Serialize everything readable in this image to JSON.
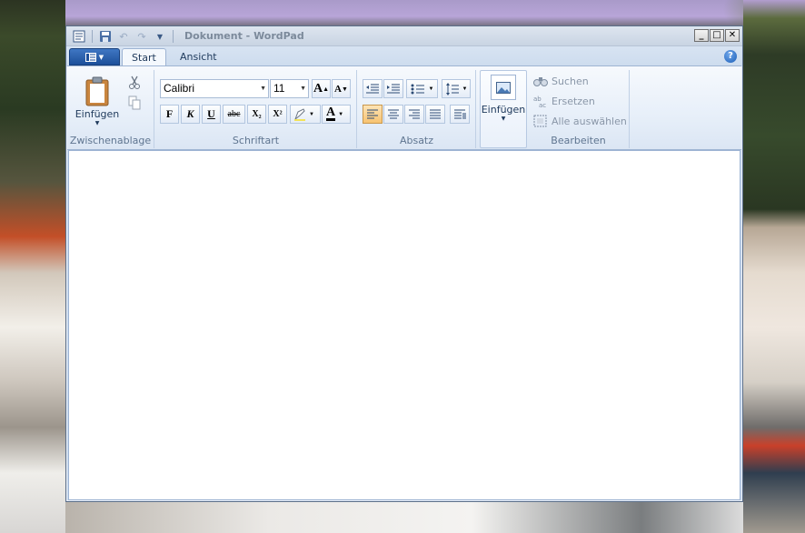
{
  "window": {
    "title": "Dokument - WordPad"
  },
  "tabs": [
    {
      "label": "Start",
      "active": true
    },
    {
      "label": "Ansicht",
      "active": false
    }
  ],
  "groups": {
    "clipboard": {
      "label": "Zwischenablage",
      "paste_label": "Einfügen"
    },
    "font": {
      "label": "Schriftart",
      "font_name": "Calibri",
      "font_size": "11",
      "bold": "F",
      "italic": "K",
      "underline": "U",
      "strike": "abc",
      "subscript": "X₂",
      "superscript": "X²"
    },
    "paragraph": {
      "label": "Absatz"
    },
    "insert": {
      "label": "Einfügen"
    },
    "editing": {
      "label": "Bearbeiten",
      "find": "Suchen",
      "replace": "Ersetzen",
      "select_all": "Alle auswählen"
    }
  },
  "colors": {
    "ribbon_bg": "#e7eff9",
    "accent": "#1c4f9a",
    "highlight": "#f7c371"
  }
}
